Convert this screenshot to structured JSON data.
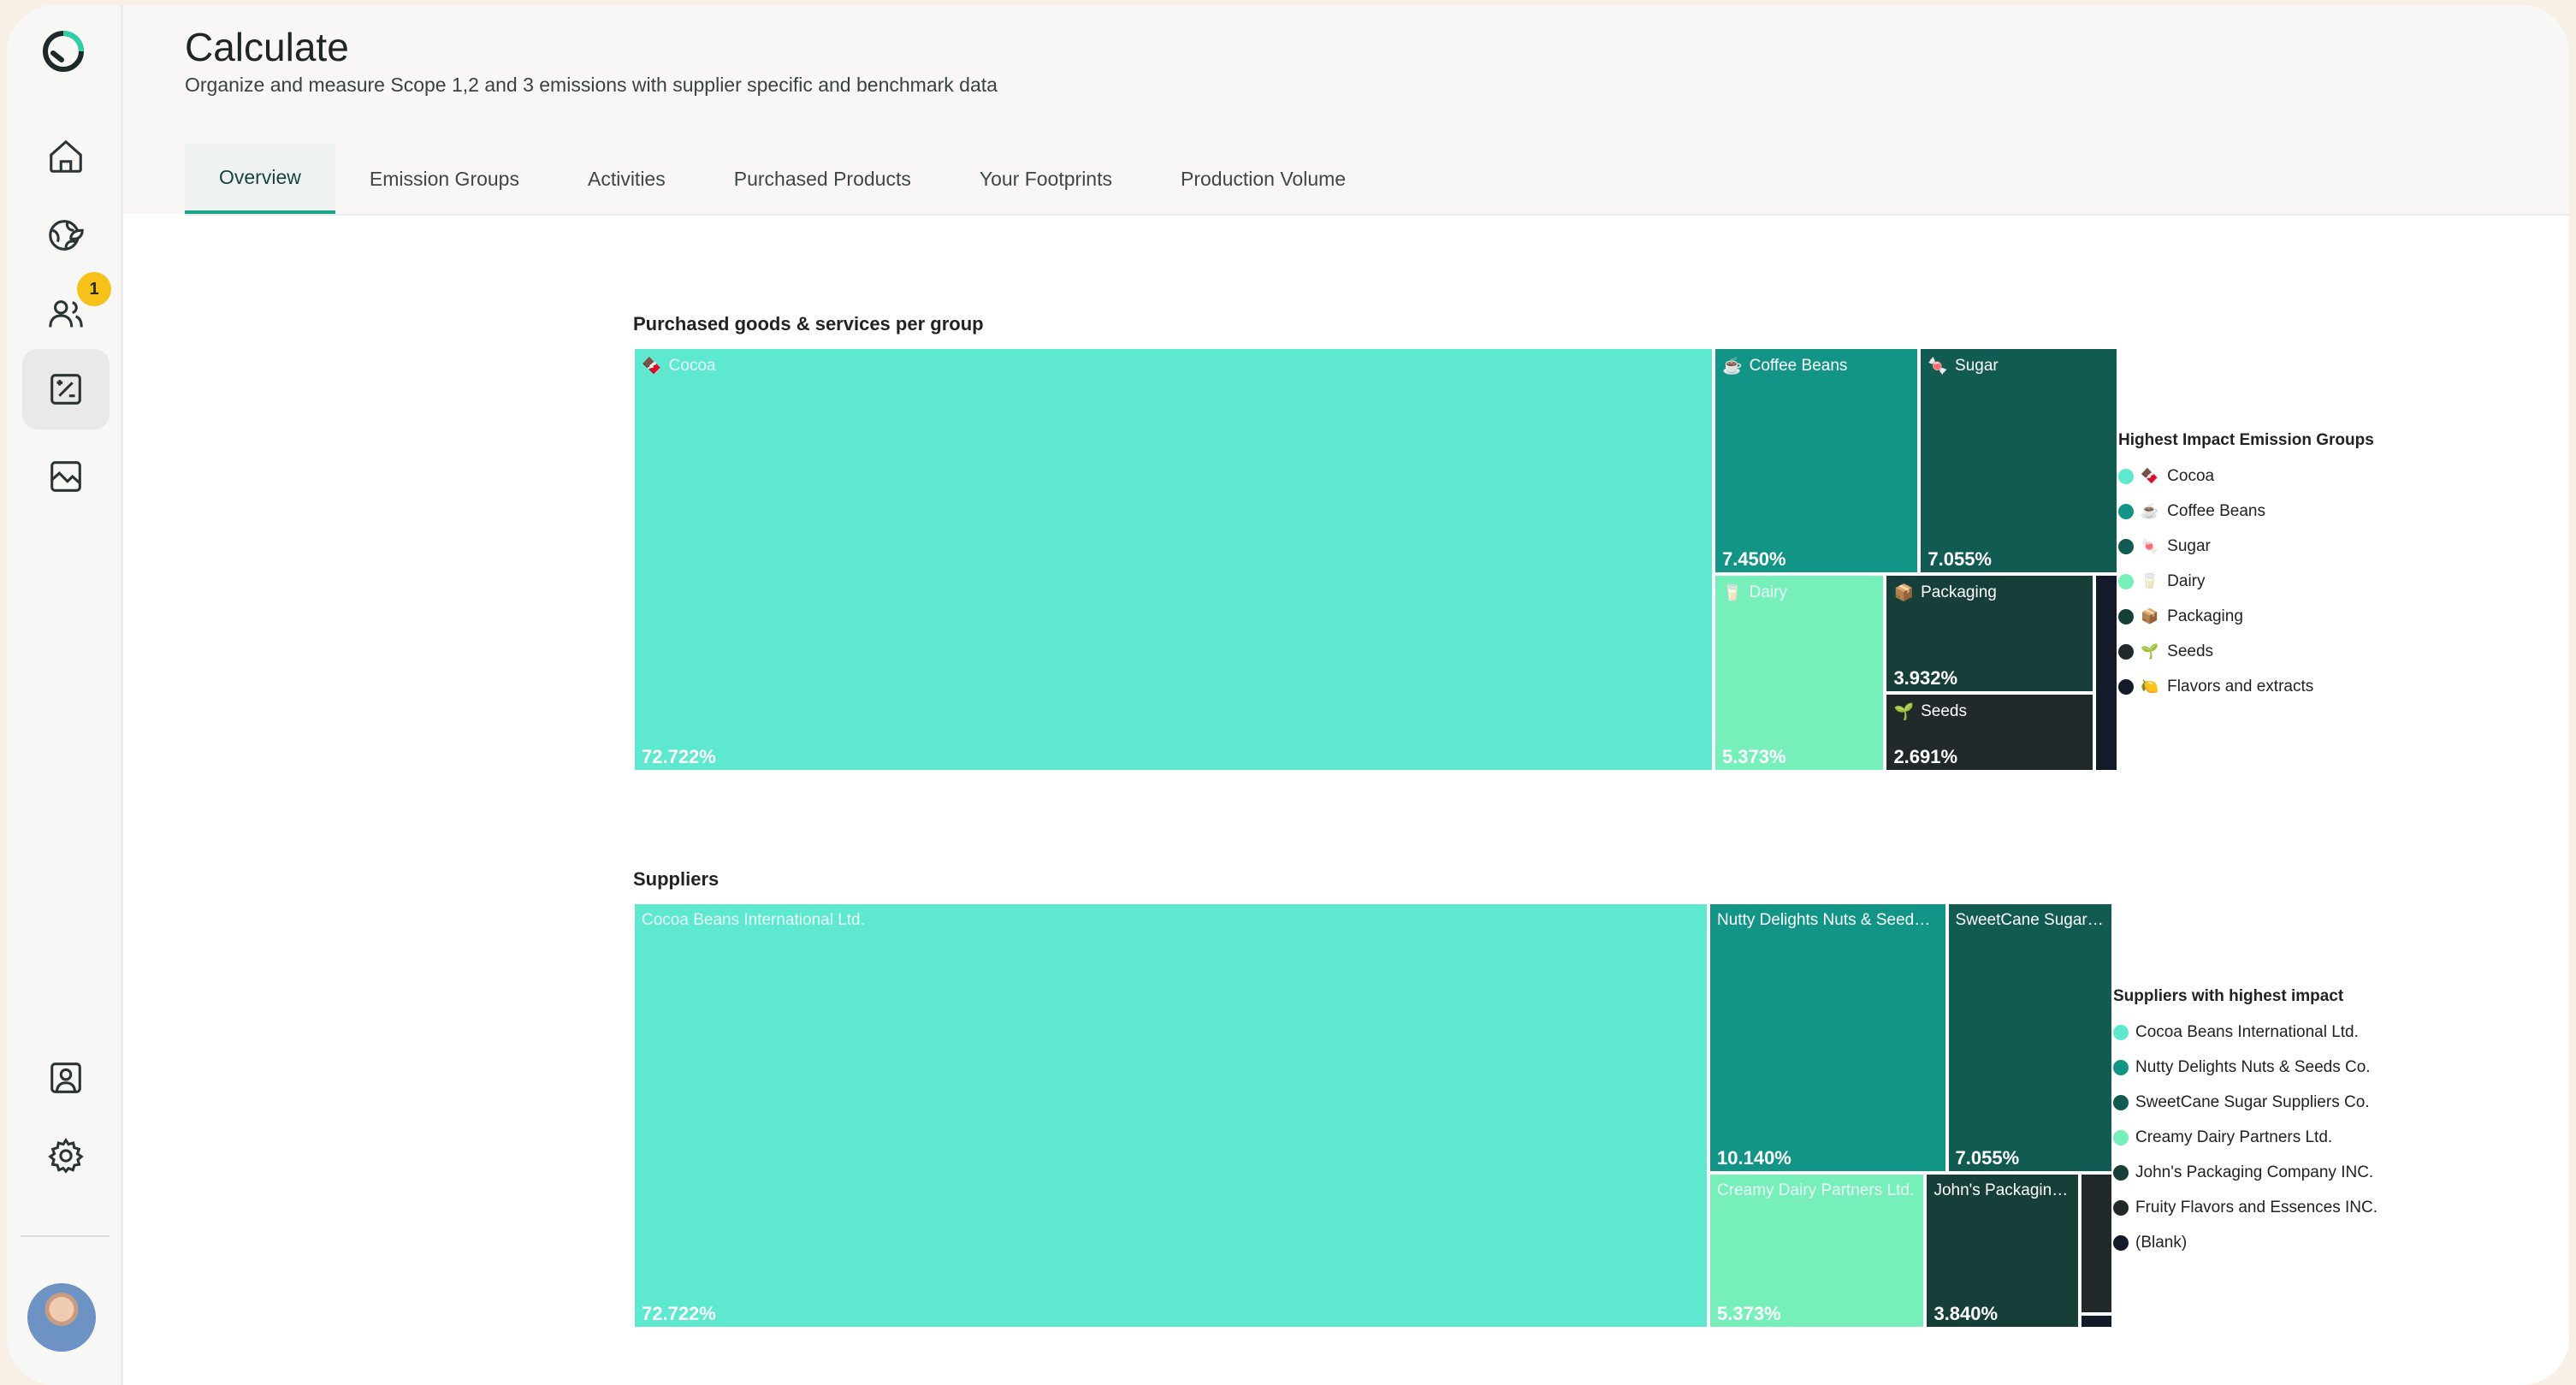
{
  "header": {
    "title": "Calculate",
    "subtitle": "Organize and measure Scope 1,2 and 3 emissions with supplier specific and benchmark data"
  },
  "tabs": [
    {
      "label": "Overview",
      "active": true
    },
    {
      "label": "Emission Groups"
    },
    {
      "label": "Activities"
    },
    {
      "label": "Purchased Products"
    },
    {
      "label": "Your Footprints"
    },
    {
      "label": "Production Volume"
    }
  ],
  "sidebar": {
    "items": [
      {
        "icon": "home-icon"
      },
      {
        "icon": "globe-leaf-icon"
      },
      {
        "icon": "users-icon",
        "badge": "1"
      },
      {
        "icon": "calculate-icon",
        "active": true
      },
      {
        "icon": "image-icon"
      },
      {
        "icon": "contact-card-icon"
      },
      {
        "icon": "gear-icon"
      }
    ]
  },
  "colors": {
    "accent": "#1ba387",
    "c1": "#5ee8cf",
    "c2": "#129586",
    "c3": "#125b53",
    "c4": "#77efba",
    "c5": "#173f3a",
    "c6": "#22292b",
    "c7": "#131a29"
  },
  "chart_data": [
    {
      "type": "treemap",
      "title": "Purchased goods & services per group",
      "legend_title": "Highest Impact Emission Groups",
      "legend_position": "right",
      "items": [
        {
          "name": "Cocoa",
          "icon": "🍫",
          "value": 72.722,
          "label": "72.722%",
          "color": "#5ee8cf"
        },
        {
          "name": "Coffee Beans",
          "icon": "☕",
          "value": 7.45,
          "label": "7.450%",
          "color": "#129586"
        },
        {
          "name": "Sugar",
          "icon": "🍬",
          "value": 7.055,
          "label": "7.055%",
          "color": "#125b53"
        },
        {
          "name": "Dairy",
          "icon": "🥛",
          "value": 5.373,
          "label": "5.373%",
          "color": "#77efba"
        },
        {
          "name": "Packaging",
          "icon": "📦",
          "value": 3.932,
          "label": "3.932%",
          "color": "#173f3a"
        },
        {
          "name": "Seeds",
          "icon": "🌱",
          "value": 2.691,
          "label": "2.691%",
          "color": "#22292b"
        },
        {
          "name": "Flavors and extracts",
          "icon": "🍋",
          "value": null,
          "label": "",
          "color": "#131a29"
        }
      ]
    },
    {
      "type": "treemap",
      "title": "Suppliers",
      "legend_title": "Suppliers with highest impact",
      "legend_position": "right",
      "items": [
        {
          "name": "Cocoa Beans International Ltd.",
          "tile_label": "Cocoa Beans International Ltd.",
          "value": 72.722,
          "label": "72.722%",
          "color": "#5ee8cf"
        },
        {
          "name": "Nutty Delights Nuts & Seeds Co.",
          "tile_label": "Nutty Delights Nuts & Seed…",
          "value": 10.14,
          "label": "10.140%",
          "color": "#129586"
        },
        {
          "name": "SweetCane Sugar Suppliers Co.",
          "tile_label": "SweetCane Sugar…",
          "value": 7.055,
          "label": "7.055%",
          "color": "#125b53"
        },
        {
          "name": "Creamy Dairy Partners Ltd.",
          "tile_label": "Creamy Dairy Partners Ltd.",
          "value": 5.373,
          "label": "5.373%",
          "color": "#77efba"
        },
        {
          "name": "John's Packaging Company INC.",
          "tile_label": "John's Packagin…",
          "value": 3.84,
          "label": "3.840%",
          "color": "#173f3a"
        },
        {
          "name": "Fruity Flavors and Essences INC.",
          "tile_label": "",
          "value": null,
          "label": "",
          "color": "#22292b"
        },
        {
          "name": "(Blank)",
          "tile_label": "",
          "value": null,
          "label": "",
          "color": "#131a29"
        }
      ]
    }
  ]
}
